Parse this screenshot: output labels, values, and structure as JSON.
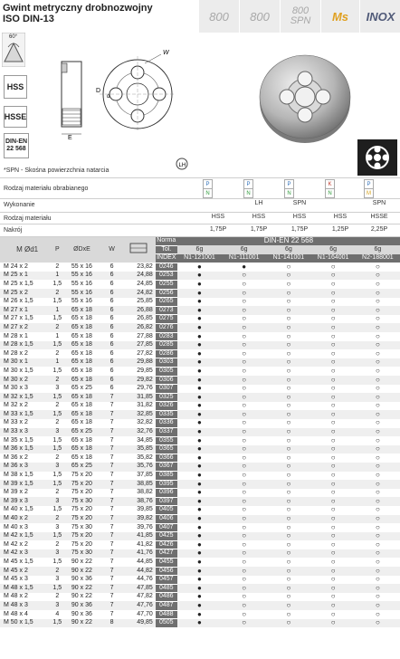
{
  "title_line1": "Gwint metryczny drobnozwojny",
  "title_line2": "ISO DIN-13",
  "header_cells": [
    {
      "label": "800",
      "style": "plain"
    },
    {
      "label": "800",
      "style": "plain"
    },
    {
      "label": "800 SPN",
      "style": "plain"
    },
    {
      "label": "Ms",
      "style": "ms"
    },
    {
      "label": "INOX",
      "style": "inox"
    }
  ],
  "badges": {
    "hss": "HSS",
    "hsse": "HSSE",
    "din": "DIN-EN 22 568"
  },
  "angle_label": "60°",
  "note": "*SPN - Skośna powierzchnia natarcia",
  "labels": {
    "rodzaj_obrab": "Rodzaj materiału obrabianego",
    "wykonanie": "Wykonanie",
    "rodzaj_mat": "Rodzaj materiału",
    "nakroj": "Nakrój"
  },
  "material_codes": [
    [
      "P",
      "N"
    ],
    [
      "P",
      "N"
    ],
    [
      "P",
      "N"
    ],
    [
      "K",
      "N"
    ],
    [
      "P",
      "M"
    ]
  ],
  "wykonanie": [
    "",
    "LH",
    "SPN",
    "",
    "SPN"
  ],
  "rodzaj_materialu": [
    "HSS",
    "HSS",
    "HSS",
    "HSS",
    "HSSE"
  ],
  "nakroj": [
    "1,75P",
    "1,75P",
    "1,75P",
    "1,25P",
    "2,25P"
  ],
  "table_header": {
    "col_m": "M Ød1",
    "col_p": "P",
    "col_dxe": "ØDxE",
    "col_w": "W",
    "norma_label": "Norma",
    "norma_value": "DIN-EN 22 568",
    "tol_label": "Tol.",
    "tol_values": [
      "6g",
      "6g",
      "6g",
      "6g",
      "6g"
    ],
    "index_label": "INDEX",
    "index_values": [
      "N1-121001",
      "N1-111001",
      "N1-141001",
      "N1-164001",
      "N2-188001"
    ]
  },
  "rows": [
    [
      "M 24 x 2",
      "2",
      "55 x 16",
      "6",
      "23,82",
      "0246"
    ],
    [
      "M 25 x 1",
      "1",
      "55 x 16",
      "6",
      "24,88",
      "0253"
    ],
    [
      "M 25 x 1,5",
      "1,5",
      "55 x 16",
      "6",
      "24,85",
      "0255"
    ],
    [
      "M 25 x 2",
      "2",
      "55 x 16",
      "6",
      "24,82",
      "0256"
    ],
    [
      "M 26 x 1,5",
      "1,5",
      "55 x 16",
      "6",
      "25,85",
      "0265"
    ],
    [
      "M 27 x 1",
      "1",
      "65 x 18",
      "6",
      "26,88",
      "0273"
    ],
    [
      "M 27 x 1,5",
      "1,5",
      "65 x 18",
      "6",
      "26,85",
      "0275"
    ],
    [
      "M 27 x 2",
      "2",
      "65 x 18",
      "6",
      "26,82",
      "0276"
    ],
    [
      "M 28 x 1",
      "1",
      "65 x 18",
      "6",
      "27,88",
      "0283"
    ],
    [
      "M 28 x 1,5",
      "1,5",
      "65 x 18",
      "6",
      "27,85",
      "0285"
    ],
    [
      "M 28 x 2",
      "2",
      "65 x 18",
      "6",
      "27,82",
      "0286"
    ],
    [
      "M 30 x 1",
      "1",
      "65 x 18",
      "6",
      "29,88",
      "0303"
    ],
    [
      "M 30 x 1,5",
      "1,5",
      "65 x 18",
      "6",
      "29,85",
      "0305"
    ],
    [
      "M 30 x 2",
      "2",
      "65 x 18",
      "6",
      "29,82",
      "0306"
    ],
    [
      "M 30 x 3",
      "3",
      "65 x 25",
      "6",
      "29,76",
      "0307"
    ],
    [
      "M 32 x 1,5",
      "1,5",
      "65 x 18",
      "7",
      "31,85",
      "0325"
    ],
    [
      "M 32 x 2",
      "2",
      "65 x 18",
      "7",
      "31,82",
      "0326"
    ],
    [
      "M 33 x 1,5",
      "1,5",
      "65 x 18",
      "7",
      "32,85",
      "0335"
    ],
    [
      "M 33 x 2",
      "2",
      "65 x 18",
      "7",
      "32,82",
      "0336"
    ],
    [
      "M 33 x 3",
      "3",
      "65 x 25",
      "7",
      "32,76",
      "0337"
    ],
    [
      "M 35 x 1,5",
      "1,5",
      "65 x 18",
      "7",
      "34,85",
      "0355"
    ],
    [
      "M 36 x 1,5",
      "1,5",
      "65 x 18",
      "7",
      "35,85",
      "0365"
    ],
    [
      "M 36 x 2",
      "2",
      "65 x 18",
      "7",
      "35,82",
      "0366"
    ],
    [
      "M 36 x 3",
      "3",
      "65 x 25",
      "7",
      "35,76",
      "0367"
    ],
    [
      "M 38 x 1,5",
      "1,5",
      "75 x 20",
      "7",
      "37,85",
      "0385"
    ],
    [
      "M 39 x 1,5",
      "1,5",
      "75 x 20",
      "7",
      "38,85",
      "0395"
    ],
    [
      "M 39 x 2",
      "2",
      "75 x 20",
      "7",
      "38,82",
      "0396"
    ],
    [
      "M 39 x 3",
      "3",
      "75 x 30",
      "7",
      "38,76",
      "0397"
    ],
    [
      "M 40 x 1,5",
      "1,5",
      "75 x 20",
      "7",
      "39,85",
      "0405"
    ],
    [
      "M 40 x 2",
      "2",
      "75 x 20",
      "7",
      "39,82",
      "0406"
    ],
    [
      "M 40 x 3",
      "3",
      "75 x 30",
      "7",
      "39,76",
      "0407"
    ],
    [
      "M 42 x 1,5",
      "1,5",
      "75 x 20",
      "7",
      "41,85",
      "0425"
    ],
    [
      "M 42 x 2",
      "2",
      "75 x 20",
      "7",
      "41,82",
      "0426"
    ],
    [
      "M 42 x 3",
      "3",
      "75 x 30",
      "7",
      "41,76",
      "0427"
    ],
    [
      "M 45 x 1,5",
      "1,5",
      "90 x 22",
      "7",
      "44,85",
      "0455"
    ],
    [
      "M 45 x 2",
      "2",
      "90 x 22",
      "7",
      "44,82",
      "0456"
    ],
    [
      "M 45 x 3",
      "3",
      "90 x 36",
      "7",
      "44,76",
      "0457"
    ],
    [
      "M 48 x 1,5",
      "1,5",
      "90 x 22",
      "7",
      "47,85",
      "0485"
    ],
    [
      "M 48 x 2",
      "2",
      "90 x 22",
      "7",
      "47,82",
      "0486"
    ],
    [
      "M 48 x 3",
      "3",
      "90 x 36",
      "7",
      "47,76",
      "0487"
    ],
    [
      "M 48 x 4",
      "4",
      "90 x 36",
      "7",
      "47,70",
      "0488"
    ],
    [
      "M 50 x 1,5",
      "1,5",
      "90 x 22",
      "8",
      "49,85",
      "0505"
    ]
  ],
  "marks": {
    "filled": "●",
    "empty": "○"
  },
  "availability": [
    [
      "f",
      "f",
      "e",
      "e",
      "e"
    ],
    [
      "f",
      "e",
      "e",
      "e",
      "e"
    ],
    [
      "f",
      "e",
      "e",
      "e",
      "e"
    ],
    [
      "f",
      "e",
      "e",
      "e",
      "e"
    ],
    [
      "f",
      "e",
      "e",
      "e",
      "e"
    ],
    [
      "f",
      "e",
      "e",
      "e",
      "e"
    ],
    [
      "f",
      "e",
      "e",
      "e",
      "e"
    ],
    [
      "f",
      "e",
      "e",
      "e",
      "e"
    ],
    [
      "f",
      "e",
      "e",
      "e",
      "e"
    ],
    [
      "f",
      "e",
      "e",
      "e",
      "e"
    ],
    [
      "f",
      "e",
      "e",
      "e",
      "e"
    ],
    [
      "f",
      "e",
      "e",
      "e",
      "e"
    ],
    [
      "f",
      "e",
      "e",
      "e",
      "e"
    ],
    [
      "f",
      "e",
      "e",
      "e",
      "e"
    ],
    [
      "f",
      "e",
      "e",
      "e",
      "e"
    ],
    [
      "f",
      "e",
      "e",
      "e",
      "e"
    ],
    [
      "f",
      "e",
      "e",
      "e",
      "e"
    ],
    [
      "f",
      "e",
      "e",
      "e",
      "e"
    ],
    [
      "f",
      "e",
      "e",
      "e",
      "e"
    ],
    [
      "f",
      "e",
      "e",
      "e",
      "e"
    ],
    [
      "f",
      "e",
      "e",
      "e",
      "e"
    ],
    [
      "f",
      "e",
      "e",
      "e",
      "e"
    ],
    [
      "f",
      "e",
      "e",
      "e",
      "e"
    ],
    [
      "f",
      "e",
      "e",
      "e",
      "e"
    ],
    [
      "f",
      "e",
      "e",
      "e",
      "e"
    ],
    [
      "f",
      "e",
      "e",
      "e",
      "e"
    ],
    [
      "f",
      "e",
      "e",
      "e",
      "e"
    ],
    [
      "f",
      "e",
      "e",
      "e",
      "e"
    ],
    [
      "f",
      "e",
      "e",
      "e",
      "e"
    ],
    [
      "f",
      "e",
      "e",
      "e",
      "e"
    ],
    [
      "f",
      "e",
      "e",
      "e",
      "e"
    ],
    [
      "f",
      "e",
      "e",
      "e",
      "e"
    ],
    [
      "f",
      "e",
      "e",
      "e",
      "e"
    ],
    [
      "f",
      "e",
      "e",
      "e",
      "e"
    ],
    [
      "f",
      "e",
      "e",
      "e",
      "e"
    ],
    [
      "f",
      "e",
      "e",
      "e",
      "e"
    ],
    [
      "f",
      "e",
      "e",
      "e",
      "e"
    ],
    [
      "f",
      "e",
      "e",
      "e",
      "e"
    ],
    [
      "f",
      "e",
      "e",
      "e",
      "e"
    ],
    [
      "f",
      "e",
      "e",
      "e",
      "e"
    ],
    [
      "f",
      "e",
      "e",
      "e",
      "e"
    ],
    [
      "f",
      "e",
      "e",
      "e",
      "e"
    ]
  ],
  "colors": {
    "index_bg": "#6f6f6f",
    "ms": "#e0a020",
    "inox": "#505a78"
  }
}
